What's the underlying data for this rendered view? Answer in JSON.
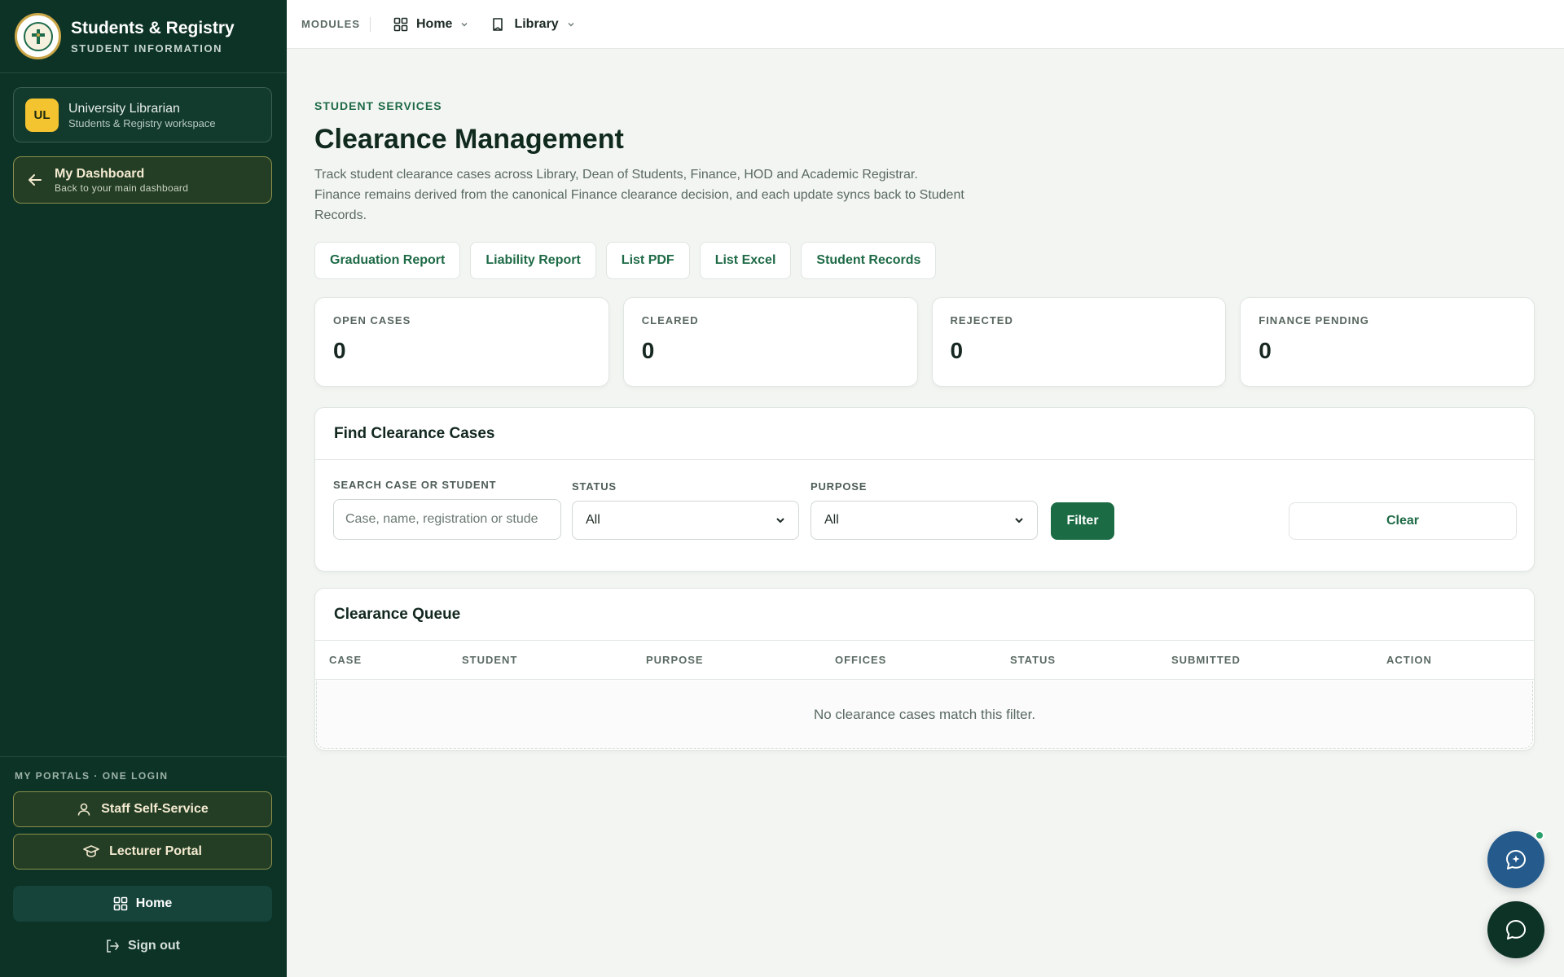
{
  "brand": {
    "title": "Students & Registry",
    "subtitle": "STUDENT INFORMATION"
  },
  "user": {
    "initials": "UL",
    "name": "University Librarian",
    "workspace": "Students & Registry workspace"
  },
  "dashboard": {
    "title": "My Dashboard",
    "subtitle": "Back to your main dashboard"
  },
  "portals": {
    "label": "MY PORTALS · ONE LOGIN",
    "items": [
      {
        "label": "Staff Self-Service",
        "icon": "user-icon"
      },
      {
        "label": "Lecturer Portal",
        "icon": "graduation-cap-icon"
      }
    ],
    "home_label": "Home",
    "signout_label": "Sign out"
  },
  "topbar": {
    "modules_label": "MODULES",
    "items": [
      {
        "label": "Home",
        "icon": "grid-icon"
      },
      {
        "label": "Library",
        "icon": "book-icon"
      }
    ]
  },
  "page": {
    "eyebrow": "STUDENT SERVICES",
    "title": "Clearance Management",
    "description": "Track student clearance cases across Library, Dean of Students, Finance, HOD and Academic Registrar. Finance remains derived from the canonical Finance clearance decision, and each update syncs back to Student Records."
  },
  "actions": [
    "Graduation Report",
    "Liability Report",
    "List PDF",
    "List Excel",
    "Student Records"
  ],
  "stats": [
    {
      "label": "OPEN CASES",
      "value": "0"
    },
    {
      "label": "CLEARED",
      "value": "0"
    },
    {
      "label": "REJECTED",
      "value": "0"
    },
    {
      "label": "FINANCE PENDING",
      "value": "0"
    }
  ],
  "filters": {
    "title": "Find Clearance Cases",
    "search_label": "SEARCH CASE OR STUDENT",
    "search_placeholder": "Case, name, registration or stude",
    "status_label": "STATUS",
    "status_value": "All",
    "purpose_label": "PURPOSE",
    "purpose_value": "All",
    "filter_button": "Filter",
    "clear_button": "Clear"
  },
  "queue": {
    "title": "Clearance Queue",
    "columns": [
      "CASE",
      "STUDENT",
      "PURPOSE",
      "OFFICES",
      "STATUS",
      "SUBMITTED",
      "ACTION"
    ],
    "empty_text": "No clearance cases match this filter."
  },
  "colors": {
    "sidebar": "#0c3326",
    "accent": "#1b6b44",
    "brand_gold": "#f3c430",
    "fab_blue": "#245b8c"
  }
}
